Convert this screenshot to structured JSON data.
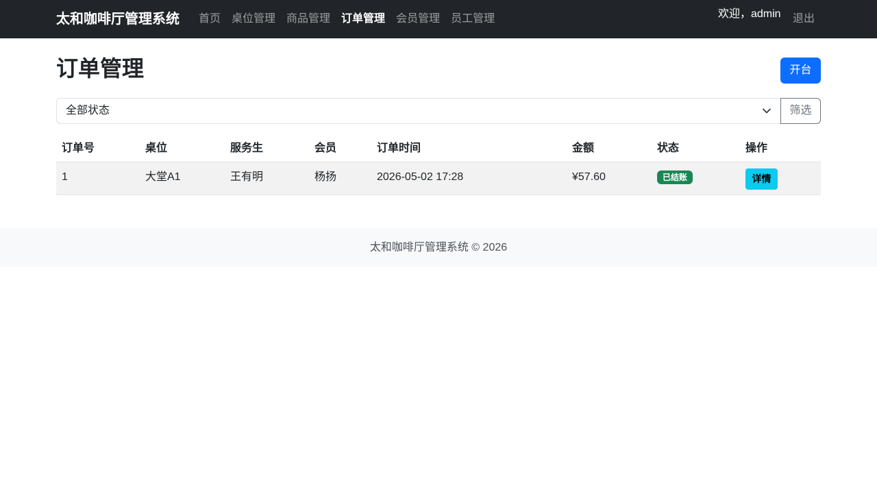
{
  "navbar": {
    "brand": "太和咖啡厅管理系统",
    "items": [
      {
        "label": "首页"
      },
      {
        "label": "桌位管理"
      },
      {
        "label": "商品管理"
      },
      {
        "label": "订单管理"
      },
      {
        "label": "会员管理"
      },
      {
        "label": "员工管理"
      }
    ],
    "active_index": 3,
    "welcome": "欢迎，admin",
    "logout": "退出"
  },
  "page": {
    "title": "订单管理",
    "open_table_button": "开台"
  },
  "filter": {
    "selected": "全部状态",
    "button": "筛选"
  },
  "table": {
    "headers": [
      "订单号",
      "桌位",
      "服务生",
      "会员",
      "订单时间",
      "金额",
      "状态",
      "操作"
    ],
    "rows": [
      {
        "order_id": "1",
        "table": "大堂A1",
        "waiter": "王有明",
        "member": "杨扬",
        "time": "2026-05-02 17:28",
        "amount": "¥57.60",
        "status": "已结账",
        "action": "详情"
      }
    ]
  },
  "footer": {
    "text": "太和咖啡厅管理系统 © 2026"
  },
  "colors": {
    "navbar_bg": "#212529",
    "primary": "#0d6efd",
    "success": "#198754",
    "info": "#0dcaf0"
  },
  "icons": {
    "select_caret": "chevron-down-icon"
  }
}
